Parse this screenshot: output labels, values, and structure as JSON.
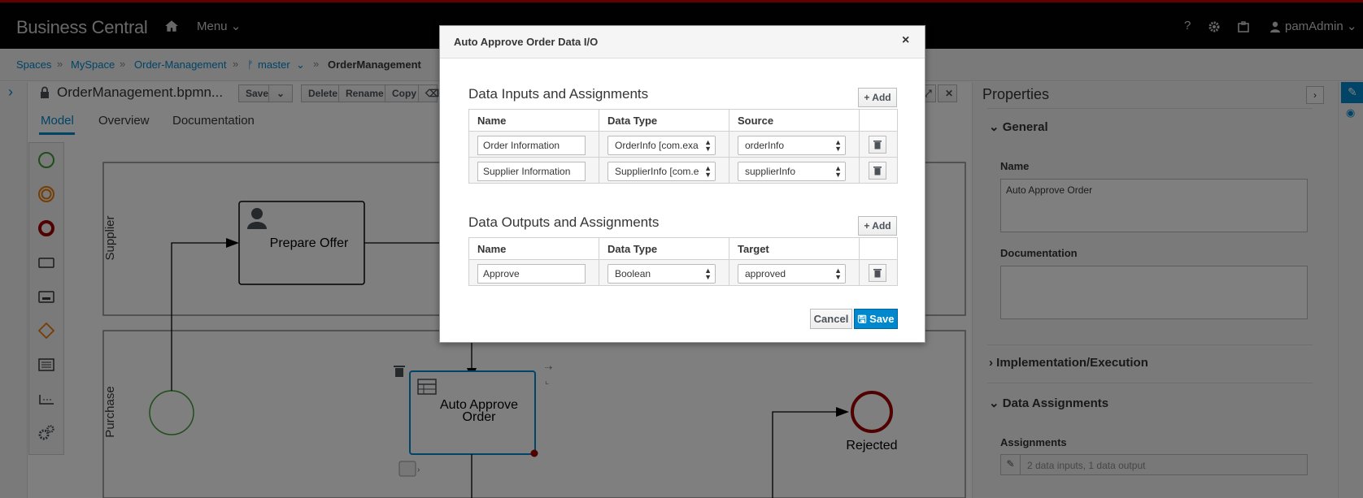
{
  "app": {
    "brand": "Business Central",
    "menu_label": "Menu",
    "user": "pamAdmin"
  },
  "breadcrumb": {
    "spaces": "Spaces",
    "space": "MySpace",
    "project": "Order-Management",
    "branch": "master",
    "asset": "OrderManagement"
  },
  "editor": {
    "title": "OrderManagement.bpmn...",
    "toolbar": {
      "save": "Save",
      "delete": "Delete",
      "rename": "Rename",
      "copy": "Copy"
    },
    "tabs": [
      "Model",
      "Overview",
      "Documentation"
    ]
  },
  "canvas": {
    "lanes": [
      "Supplier",
      "Purchase"
    ],
    "tasks": {
      "prepare_offer": "Prepare Offer",
      "auto_approve_line1": "Auto Approve",
      "auto_approve_line2": "Order"
    },
    "end_event": "Rejected"
  },
  "properties": {
    "title": "Properties",
    "general": "General",
    "name_label": "Name",
    "name_value": "Auto Approve Order",
    "documentation_label": "Documentation",
    "implementation": "Implementation/Execution",
    "data_assignments": "Data Assignments",
    "assignments_label": "Assignments",
    "assignments_value": "2 data inputs, 1 data output"
  },
  "dialog": {
    "title": "Auto Approve Order Data I/O",
    "close": "×",
    "inputs": {
      "title": "Data Inputs and Assignments",
      "add": "Add",
      "headers": [
        "Name",
        "Data Type",
        "Source"
      ],
      "rows": [
        {
          "name": "Order Information",
          "type": "OrderInfo [com.exa",
          "source": "orderInfo"
        },
        {
          "name": "Supplier Information",
          "type": "SupplierInfo [com.e",
          "source": "supplierInfo"
        }
      ]
    },
    "outputs": {
      "title": "Data Outputs and Assignments",
      "add": "Add",
      "headers": [
        "Name",
        "Data Type",
        "Target"
      ],
      "rows": [
        {
          "name": "Approve",
          "type": "Boolean",
          "target": "approved"
        }
      ]
    },
    "cancel": "Cancel",
    "save": "Save"
  },
  "colors": {
    "accent": "#0088ce",
    "topbar": "#030303",
    "top_stripe": "#cc0000",
    "start": "#3f9c35",
    "end": "#a30000",
    "gateway": "#ec7a08"
  }
}
